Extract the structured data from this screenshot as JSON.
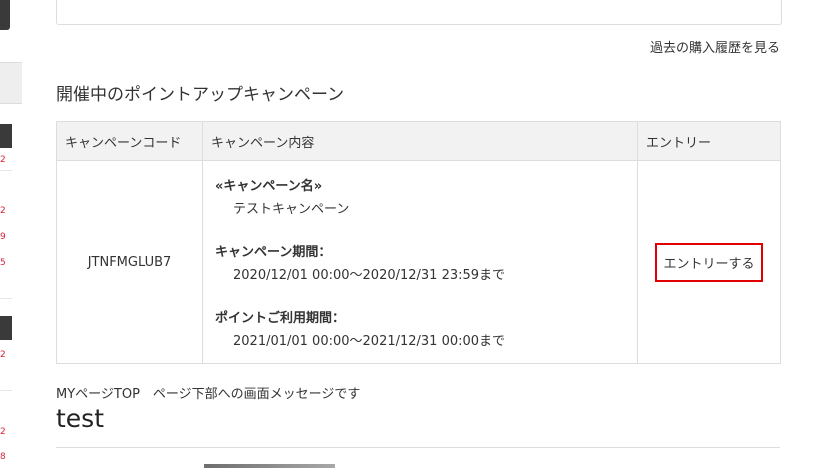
{
  "history_link": "過去の購入履歴を見る",
  "section_title": "開催中のポイントアップキャンペーン",
  "table": {
    "headers": {
      "code": "キャンペーンコード",
      "content": "キャンペーン内容",
      "entry": "エントリー"
    },
    "row": {
      "code": "JTNFMGLUB7",
      "name_label": "«キャンペーン名»",
      "name_value": "テストキャンペーン",
      "period_label": "キャンペーン期間：",
      "period_value": "2020/12/01 00:00～2020/12/31 23:59まで",
      "usage_label": "ポイントご利用期間：",
      "usage_value": "2021/01/01 00:00～2021/12/31 00:00まで",
      "entry_button": "エントリーする"
    }
  },
  "bottom": {
    "message": "MYページTOP　ページ下部への画面メッセージです",
    "heading": "test"
  },
  "sidebar": {
    "marks": [
      "2",
      "2",
      "9",
      "5",
      "2",
      "2",
      "8"
    ]
  },
  "colors": {
    "highlight_border": "#e00000",
    "header_bg": "#f2f2f2",
    "sidebar_dark": "#3a3a3a",
    "sidebar_mark": "#d3243b"
  }
}
